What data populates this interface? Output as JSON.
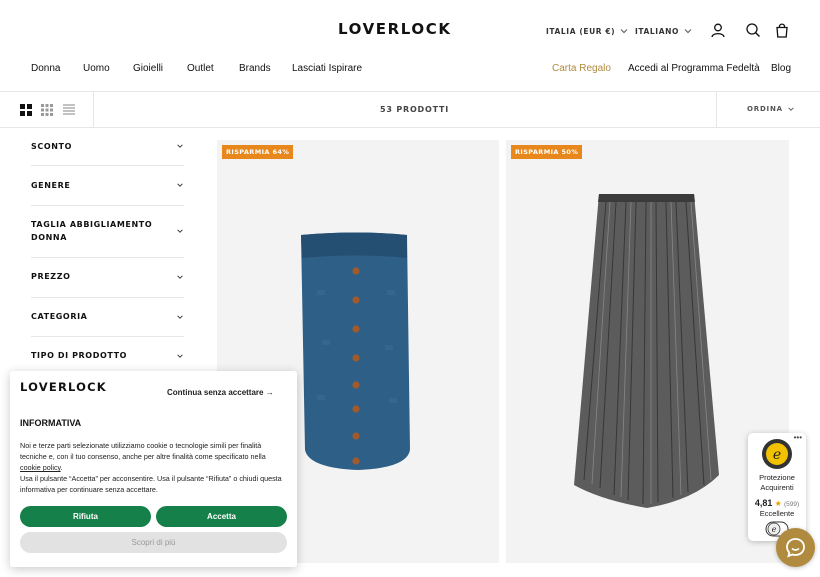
{
  "header": {
    "logo": "LOVERLOCK",
    "country": "ITALIA (EUR €)",
    "language": "ITALIANO"
  },
  "nav": {
    "left": [
      "Donna",
      "Uomo",
      "Gioielli",
      "Outlet",
      "Brands",
      "Lasciati Ispirare"
    ],
    "right": [
      "Carta Regalo",
      "Accedi al Programma Fedeltà",
      "Blog"
    ]
  },
  "toolbar": {
    "product_count": "53 PRODOTTI",
    "sort_label": "ORDINA"
  },
  "filters": [
    "SCONTO",
    "GENERE",
    "TAGLIA ABBIGLIAMENTO DONNA",
    "PREZZO",
    "CATEGORIA",
    "TIPO DI PRODOTTO"
  ],
  "products": [
    {
      "badge": "RISPARMIA 64%"
    },
    {
      "badge": "RISPARMIA 50%"
    }
  ],
  "cookie": {
    "logo": "LOVERLOCK",
    "continue_without": "Continua senza accettare →",
    "title": "INFORMATIVA",
    "text1": "Noi e terze parti selezionate utilizziamo cookie o tecnologie simili per finalità tecniche e, con il tuo consenso, anche per altre finalità come specificato nella",
    "policy_link": "cookie policy",
    "text1_end": ".",
    "text2": "Usa il pulsante “Accetta” per acconsentire. Usa il pulsante “Rifiuta” o chiudi questa informativa per continuare senza accettare.",
    "reject": "Rifiuta",
    "accept": "Accetta",
    "more": "Scopri di più"
  },
  "trusted": {
    "label_line1": "Protezione",
    "label_line2": "Acquirenti",
    "rating": "4,81",
    "count": "(599)",
    "verdict": "Eccellente"
  },
  "colors": {
    "accent_gold": "#b08a3e",
    "badge_orange": "#e8881c",
    "cookie_green": "#16804a"
  }
}
